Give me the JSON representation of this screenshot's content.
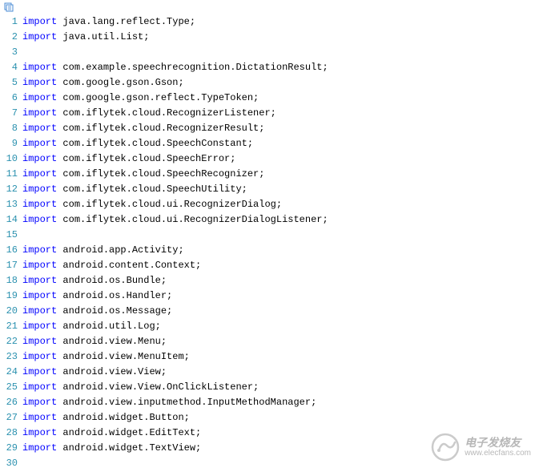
{
  "lines": [
    {
      "n": 1,
      "k": "import",
      "t": " java.lang.reflect.Type;"
    },
    {
      "n": 2,
      "k": "import",
      "t": " java.util.List;"
    },
    {
      "n": 3,
      "k": "",
      "t": ""
    },
    {
      "n": 4,
      "k": "import",
      "t": " com.example.speechrecognition.DictationResult;"
    },
    {
      "n": 5,
      "k": "import",
      "t": " com.google.gson.Gson;"
    },
    {
      "n": 6,
      "k": "import",
      "t": " com.google.gson.reflect.TypeToken;"
    },
    {
      "n": 7,
      "k": "import",
      "t": " com.iflytek.cloud.RecognizerListener;"
    },
    {
      "n": 8,
      "k": "import",
      "t": " com.iflytek.cloud.RecognizerResult;"
    },
    {
      "n": 9,
      "k": "import",
      "t": " com.iflytek.cloud.SpeechConstant;"
    },
    {
      "n": 10,
      "k": "import",
      "t": " com.iflytek.cloud.SpeechError;"
    },
    {
      "n": 11,
      "k": "import",
      "t": " com.iflytek.cloud.SpeechRecognizer;"
    },
    {
      "n": 12,
      "k": "import",
      "t": " com.iflytek.cloud.SpeechUtility;"
    },
    {
      "n": 13,
      "k": "import",
      "t": " com.iflytek.cloud.ui.RecognizerDialog;"
    },
    {
      "n": 14,
      "k": "import",
      "t": " com.iflytek.cloud.ui.RecognizerDialogListener;"
    },
    {
      "n": 15,
      "k": "",
      "t": ""
    },
    {
      "n": 16,
      "k": "import",
      "t": " android.app.Activity;"
    },
    {
      "n": 17,
      "k": "import",
      "t": " android.content.Context;"
    },
    {
      "n": 18,
      "k": "import",
      "t": " android.os.Bundle;"
    },
    {
      "n": 19,
      "k": "import",
      "t": " android.os.Handler;"
    },
    {
      "n": 20,
      "k": "import",
      "t": " android.os.Message;"
    },
    {
      "n": 21,
      "k": "import",
      "t": " android.util.Log;"
    },
    {
      "n": 22,
      "k": "import",
      "t": " android.view.Menu;"
    },
    {
      "n": 23,
      "k": "import",
      "t": " android.view.MenuItem;"
    },
    {
      "n": 24,
      "k": "import",
      "t": " android.view.View;"
    },
    {
      "n": 25,
      "k": "import",
      "t": " android.view.View.OnClickListener;"
    },
    {
      "n": 26,
      "k": "import",
      "t": " android.view.inputmethod.InputMethodManager;"
    },
    {
      "n": 27,
      "k": "import",
      "t": " android.widget.Button;"
    },
    {
      "n": 28,
      "k": "import",
      "t": " android.widget.EditText;"
    },
    {
      "n": 29,
      "k": "import",
      "t": " android.widget.TextView;"
    },
    {
      "n": 30,
      "k": "",
      "t": ""
    }
  ],
  "watermark": {
    "title": "电子发烧友",
    "url": "www.elecfans.com"
  }
}
